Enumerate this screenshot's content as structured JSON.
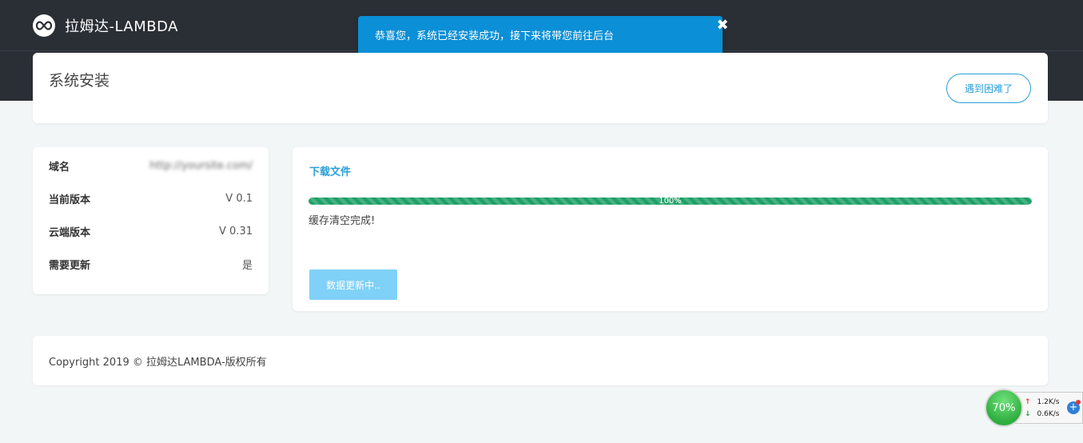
{
  "header": {
    "brand_name": "拉姆达-LAMBDA",
    "logo_icon": "infinity-icon"
  },
  "toast": {
    "message": "恭喜您，系统已经安装成功，接下来将带您前往后台",
    "close_label": "✖"
  },
  "page": {
    "title": "系统安装",
    "help_button": "遇到困难了"
  },
  "info": {
    "rows": [
      {
        "label": "域名",
        "value": "http://yoursite.com/"
      },
      {
        "label": "当前版本",
        "value": "V 0.1"
      },
      {
        "label": "云端版本",
        "value": "V 0.31"
      },
      {
        "label": "需要更新",
        "value": "是"
      }
    ]
  },
  "download": {
    "title": "下载文件",
    "progress_percent": 100,
    "progress_label": "100%",
    "status": "缓存清空完成!",
    "button_label": "数据更新中.."
  },
  "footer": {
    "copyright": "Copyright 2019 © 拉姆达LAMBDA-版权所有"
  },
  "net_widget": {
    "usage": "70%",
    "upload": "1.2K/s",
    "download": "0.6K/s",
    "plus_label": "+"
  },
  "colors": {
    "accent": "#2a9fd6",
    "toast": "#0b8fd6",
    "progress": "#1fa067",
    "topbar": "#2a2f36"
  }
}
